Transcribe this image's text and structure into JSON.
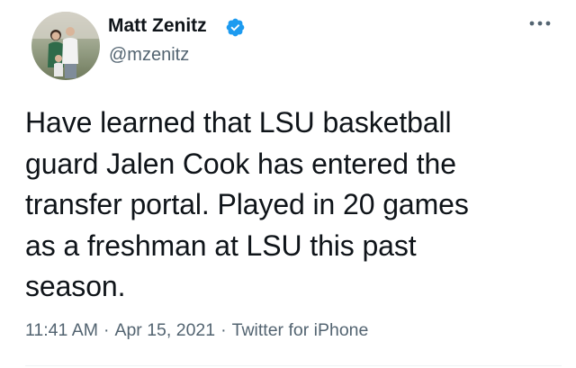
{
  "author": {
    "display_name": "Matt Zenitz",
    "handle": "@mzenitz",
    "verified": true
  },
  "tweet": {
    "text": "Have learned that LSU basketball\nguard Jalen Cook has entered the\ntransfer portal. Played in 20 games\nas a freshman at LSU this past\nseason.",
    "time": "11:41 AM",
    "separator": "·",
    "date": "Apr 15, 2021",
    "source": "Twitter for iPhone"
  },
  "icons": {
    "verified": "verified-badge-icon",
    "more": "more-options-icon"
  },
  "colors": {
    "verified_blue": "#1d9bf0",
    "text_primary": "#0f1419",
    "text_secondary": "#536471"
  }
}
